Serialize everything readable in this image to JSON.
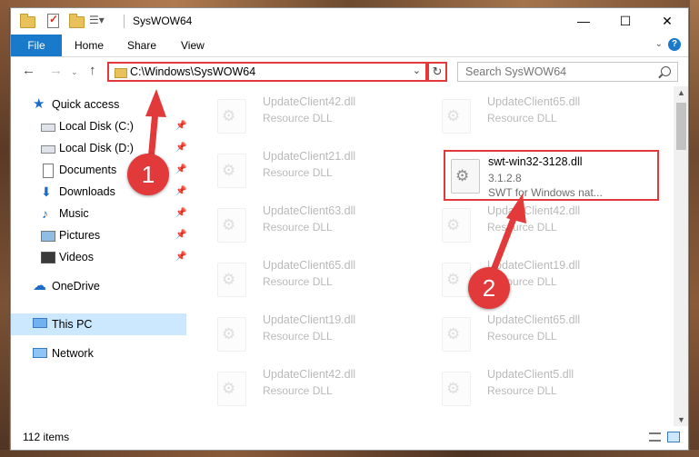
{
  "window": {
    "title": "SysWOW64",
    "controls": {
      "minimize": "—",
      "maximize": "☐",
      "close": "✕"
    }
  },
  "ribbon": {
    "file_tab": "File",
    "tabs": [
      "Home",
      "Share",
      "View"
    ],
    "help": "?"
  },
  "nav": {
    "back": "←",
    "forward": "→",
    "up": "↑",
    "address": "C:\\Windows\\SysWOW64",
    "refresh": "↻",
    "search_placeholder": "Search SysWOW64"
  },
  "sidebar": {
    "items": [
      {
        "label": "Quick access",
        "icon": "star-icon"
      },
      {
        "label": "Local Disk (C:)",
        "icon": "disk-icon",
        "pinned": true
      },
      {
        "label": "Local Disk (D:)",
        "icon": "disk-icon",
        "pinned": true
      },
      {
        "label": "Documents",
        "icon": "documents-icon",
        "pinned": true
      },
      {
        "label": "Downloads",
        "icon": "downloads-icon",
        "pinned": true
      },
      {
        "label": "Music",
        "icon": "music-icon",
        "pinned": true
      },
      {
        "label": "Pictures",
        "icon": "pictures-icon",
        "pinned": true
      },
      {
        "label": "Videos",
        "icon": "videos-icon",
        "pinned": true
      },
      {
        "label": "OneDrive",
        "icon": "cloud-icon"
      },
      {
        "label": "This PC",
        "icon": "computer-icon",
        "selected": true
      },
      {
        "label": "Network",
        "icon": "network-icon"
      }
    ]
  },
  "files": {
    "left": [
      {
        "name": "UpdateClient42.dll",
        "type": "Resource DLL"
      },
      {
        "name": "UpdateClient21.dll",
        "type": "Resource DLL"
      },
      {
        "name": "UpdateClient63.dll",
        "type": "Resource DLL"
      },
      {
        "name": "UpdateClient65.dll",
        "type": "Resource DLL"
      },
      {
        "name": "UpdateClient19.dll",
        "type": "Resource DLL"
      },
      {
        "name": "UpdateClient42.dll",
        "type": "Resource DLL"
      }
    ],
    "right": [
      {
        "name": "UpdateClient65.dll",
        "type": "Resource DLL"
      },
      {
        "name": "swt-win32-3128.dll",
        "version": "3.1.2.8",
        "description": "SWT for Windows nat...",
        "highlighted": true
      },
      {
        "name": "UpdateClient42.dll",
        "type": "Resource DLL"
      },
      {
        "name": "UpdateClient19.dll",
        "type": "Resource DLL"
      },
      {
        "name": "UpdateClient65.dll",
        "type": "Resource DLL"
      },
      {
        "name": "UpdateClient5.dll",
        "type": "Resource DLL"
      }
    ]
  },
  "status": {
    "item_count": "112 items"
  },
  "annotations": {
    "step1": "1",
    "step2": "2",
    "color": "#e23a3a"
  }
}
